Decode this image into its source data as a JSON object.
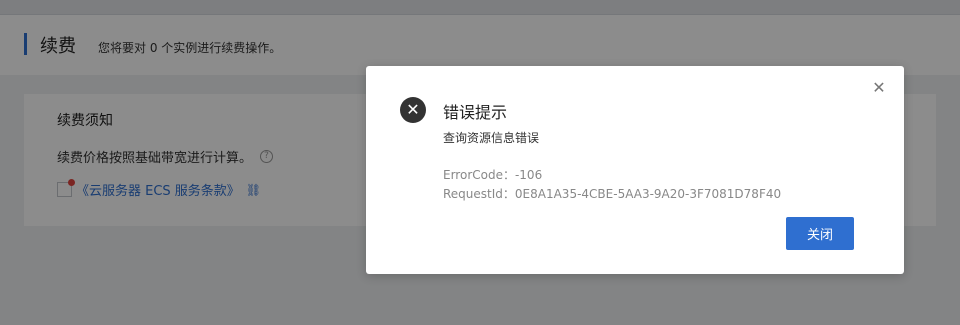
{
  "header": {
    "title": "续费",
    "description": "您将要对 0 个实例进行续费操作。"
  },
  "card": {
    "title": "续费须知",
    "notice": "续费价格按照基础带宽进行计算。",
    "help_icon": "question-circle-icon",
    "agreement_link": "《云服务器 ECS 服务条款》",
    "link_icon": "external-link-icon"
  },
  "modal": {
    "title": "错误提示",
    "message": "查询资源信息错误",
    "error_code_label": "ErrorCode",
    "error_code_value": "-106",
    "request_id_label": "RequestId",
    "request_id_value": "0E8A1A35-4CBE-5AA3-9A20-3F7081D78F40",
    "error_code_text": "ErrorCode：-106",
    "request_id_text": "RequestId：0E8A1A35-4CBE-5AA3-9A20-3F7081D78F40",
    "close_button_label": "关闭",
    "status_icon": "error-x-circle-icon"
  },
  "colors": {
    "accent": "#2f6fd0",
    "overlay": "rgba(0,0,0,0.45)",
    "error_icon": "#333333"
  }
}
